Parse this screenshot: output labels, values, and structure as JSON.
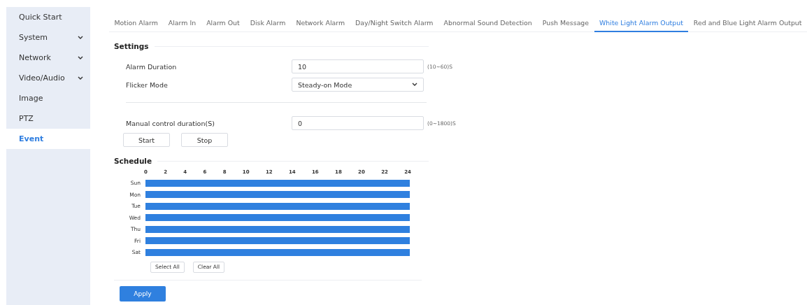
{
  "sidebar": {
    "items": [
      {
        "label": "Quick Start",
        "expandable": false,
        "selected": false
      },
      {
        "label": "System",
        "expandable": true,
        "selected": false
      },
      {
        "label": "Network",
        "expandable": true,
        "selected": false
      },
      {
        "label": "Video/Audio",
        "expandable": true,
        "selected": false
      },
      {
        "label": "Image",
        "expandable": false,
        "selected": false
      },
      {
        "label": "PTZ",
        "expandable": false,
        "selected": false
      },
      {
        "label": "Event",
        "expandable": false,
        "selected": true
      }
    ]
  },
  "tabs": [
    {
      "label": "Motion Alarm",
      "selected": false
    },
    {
      "label": "Alarm In",
      "selected": false
    },
    {
      "label": "Alarm Out",
      "selected": false
    },
    {
      "label": "Disk Alarm",
      "selected": false
    },
    {
      "label": "Network Alarm",
      "selected": false
    },
    {
      "label": "Day/Night Switch Alarm",
      "selected": false
    },
    {
      "label": "Abnormal Sound Detection",
      "selected": false
    },
    {
      "label": "Push Message",
      "selected": false
    },
    {
      "label": "White Light Alarm Output",
      "selected": true
    },
    {
      "label": "Red and Blue Light Alarm Output",
      "selected": false
    }
  ],
  "settings": {
    "title": "Settings",
    "fields": [
      {
        "kind": "input",
        "label": "Alarm Duration",
        "value": "10",
        "hint": "(10~60)S"
      },
      {
        "kind": "select",
        "label": "Flicker Mode",
        "value": "Steady-on Mode"
      },
      {
        "kind": "divider"
      },
      {
        "kind": "input",
        "label": "Manual control duration(S)",
        "value": "0",
        "hint": "(0~1800)S"
      }
    ],
    "buttons": [
      "Start",
      "Stop"
    ]
  },
  "schedule": {
    "title": "Schedule",
    "hours": [
      "0",
      "2",
      "4",
      "6",
      "8",
      "10",
      "12",
      "14",
      "16",
      "18",
      "20",
      "22",
      "24"
    ],
    "days": [
      {
        "label": "Sun",
        "on": true
      },
      {
        "label": "Mon",
        "on": true
      },
      {
        "label": "Tue",
        "on": true
      },
      {
        "label": "Wed",
        "on": true
      },
      {
        "label": "Thu",
        "on": true
      },
      {
        "label": "Fri",
        "on": true
      },
      {
        "label": "Sat",
        "on": true
      }
    ],
    "buttons": [
      "Select All",
      "Clear All"
    ]
  },
  "apply": "Apply"
}
